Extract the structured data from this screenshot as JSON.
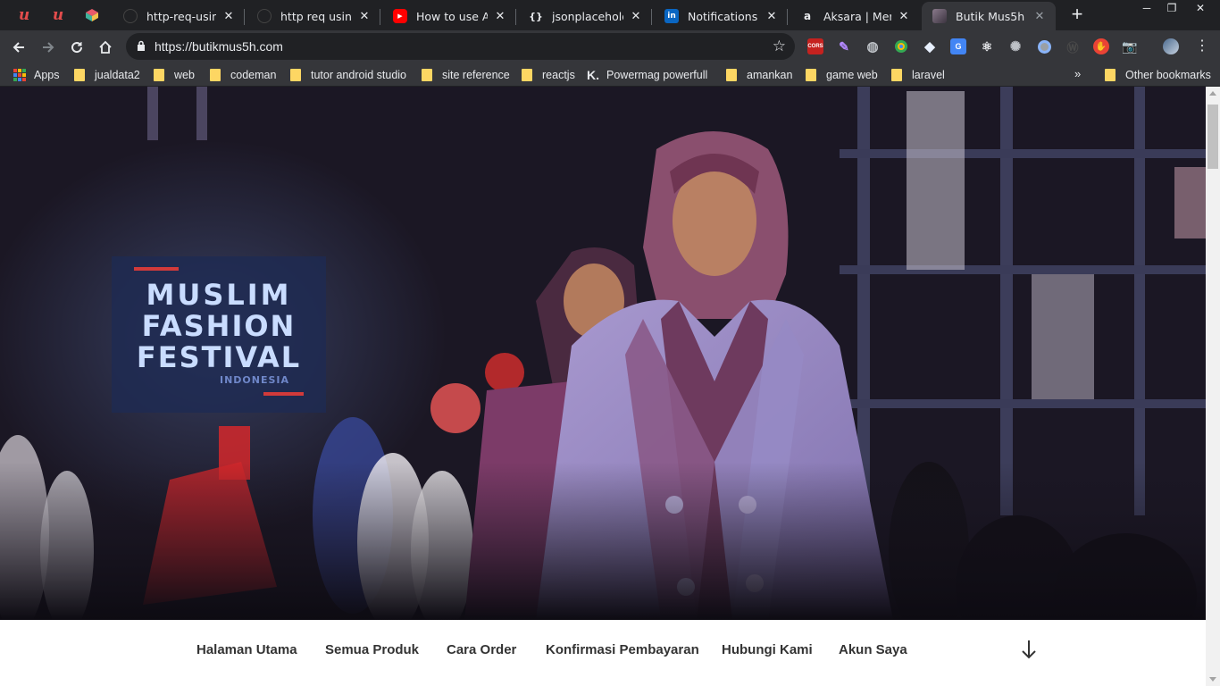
{
  "browser": {
    "tabs": [
      {
        "title": "http-req-using-a"
      },
      {
        "title": "http req using a"
      },
      {
        "title": "How to use Axio"
      },
      {
        "title": "jsonplaceholder"
      },
      {
        "title": "Notifications | Li"
      },
      {
        "title": "Aksara | Merang"
      },
      {
        "title": "Butik Mus5h"
      }
    ],
    "address_bar": {
      "url": "https://butikmus5h.com"
    },
    "extensions": [
      {
        "name": "cors-extension-icon",
        "label": "CORS"
      }
    ]
  },
  "bookmarks": {
    "items": [
      {
        "label": "Apps"
      },
      {
        "label": "jualdata2"
      },
      {
        "label": "web"
      },
      {
        "label": "codeman"
      },
      {
        "label": "tutor android studio"
      },
      {
        "label": "site reference"
      },
      {
        "label": "reactjs"
      },
      {
        "label": "Powermag powerfull"
      },
      {
        "label": "amankan"
      },
      {
        "label": "game web"
      },
      {
        "label": "laravel"
      }
    ],
    "overflow": "»",
    "other": "Other bookmarks"
  },
  "hero": {
    "sign_lines": [
      "MUSLIM",
      "FASHION",
      "FESTIVAL",
      "INDONESIA"
    ]
  },
  "site_nav": {
    "items": [
      {
        "label": "Halaman Utama"
      },
      {
        "label": "Semua Produk"
      },
      {
        "label": "Cara Order"
      },
      {
        "label": "Konfirmasi Pembayaran"
      },
      {
        "label": "Hubungi Kami"
      },
      {
        "label": "Akun Saya"
      }
    ]
  },
  "colors": {
    "tabstrip": "#202124",
    "toolbar": "#35363a",
    "folder": "#fdd663",
    "nav_text": "#333333"
  }
}
